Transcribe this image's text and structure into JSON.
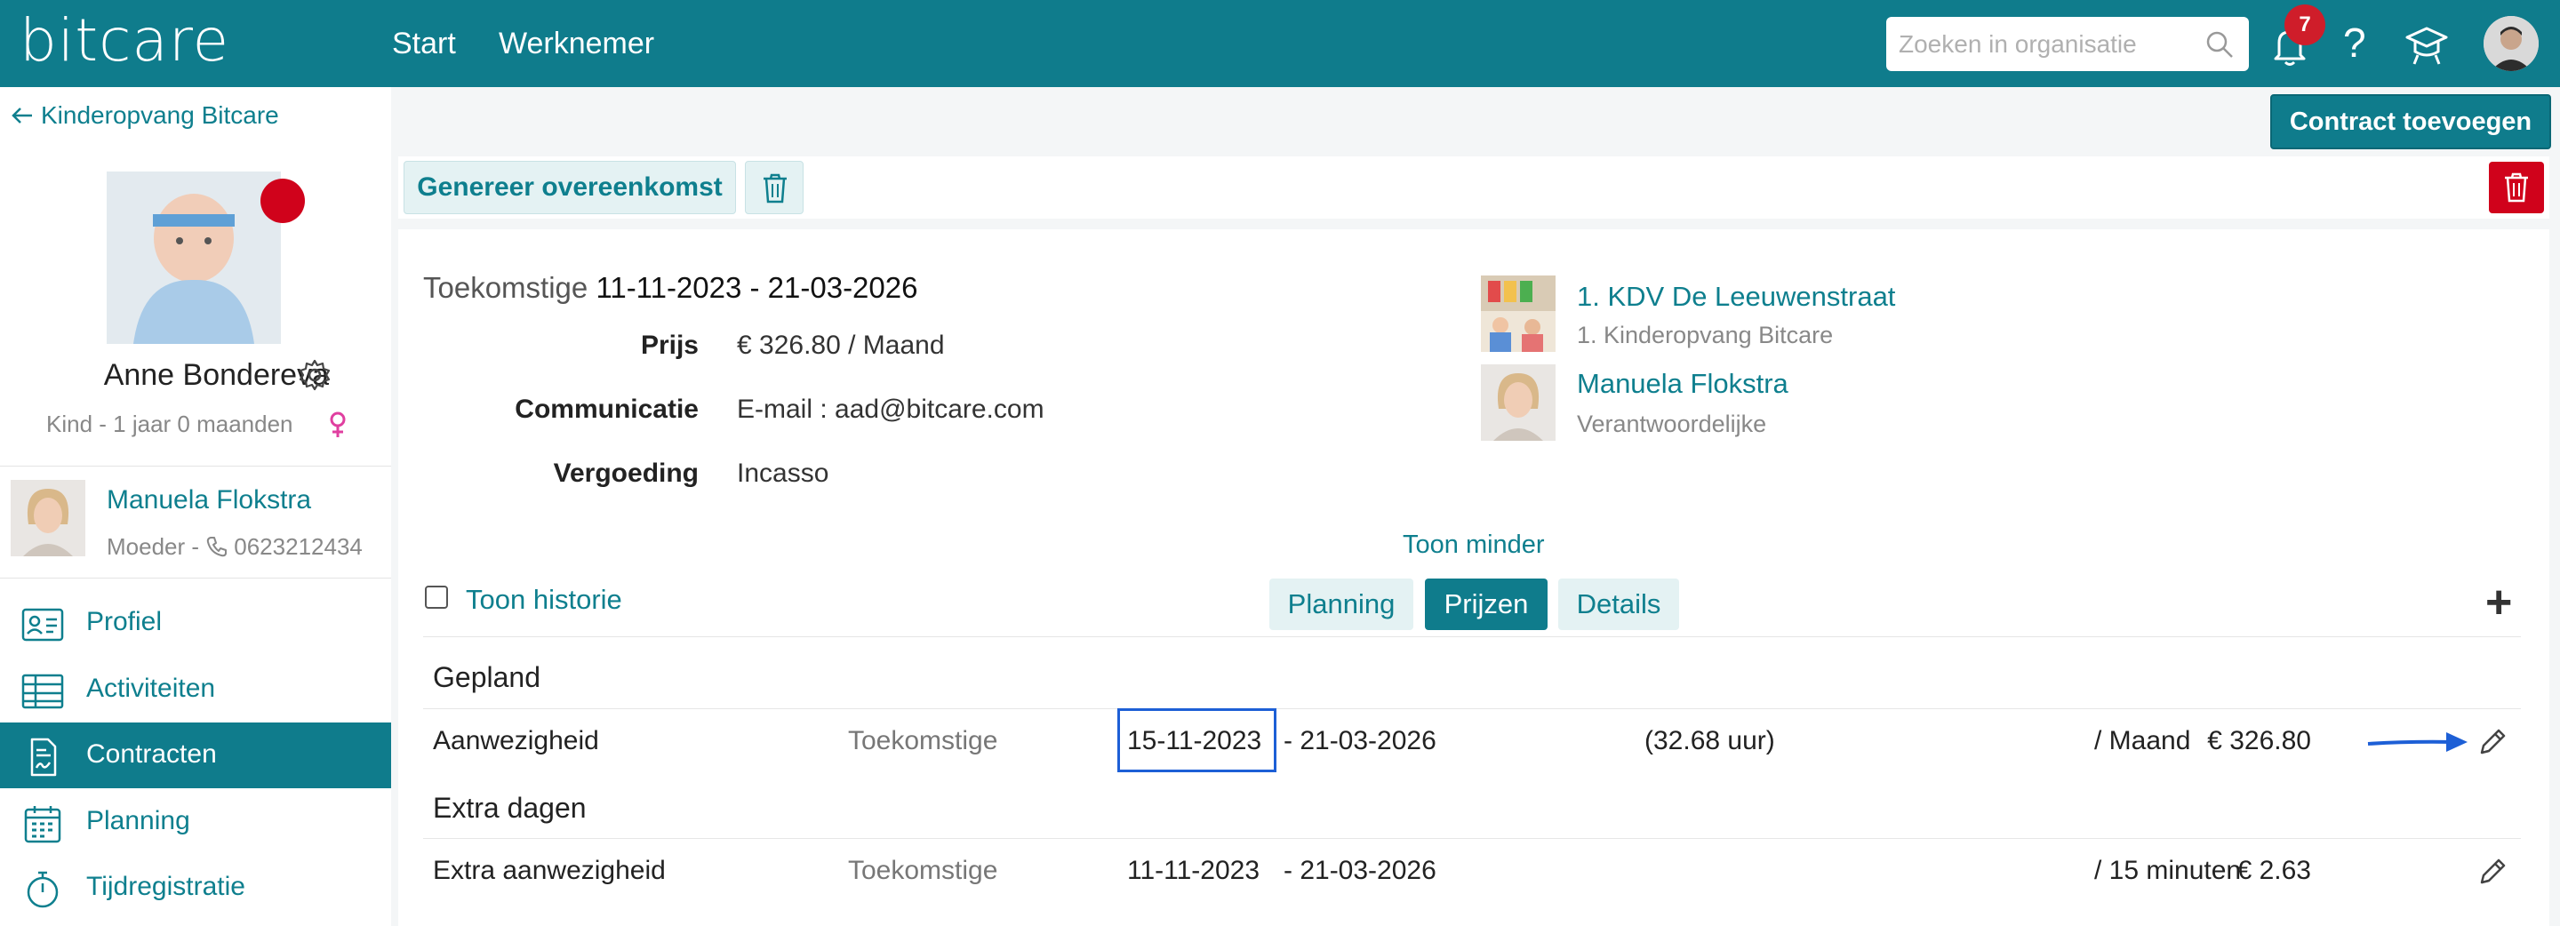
{
  "header": {
    "logo": "bitcare",
    "nav": [
      "Start",
      "Werknemer"
    ],
    "search_placeholder": "Zoeken in organisatie",
    "notification_count": "7",
    "help": "?"
  },
  "sidebar": {
    "back_label": "Kinderopvang Bitcare",
    "child_name": "Anne Bondereva",
    "child_meta": "Kind - 1 jaar 0 maanden",
    "parent_name": "Manuela Flokstra",
    "parent_meta": "Moeder - ",
    "parent_phone": "0623212434",
    "menu": [
      {
        "label": "Profiel",
        "icon": "profile-card-icon"
      },
      {
        "label": "Activiteiten",
        "icon": "table-icon"
      },
      {
        "label": "Contracten",
        "icon": "document-icon",
        "active": true
      },
      {
        "label": "Planning",
        "icon": "calendar-icon"
      },
      {
        "label": "Tijdregistratie",
        "icon": "stopwatch-icon"
      }
    ]
  },
  "actions": {
    "add_contract": "Contract toevoegen",
    "generate": "Genereer overeenkomst"
  },
  "contract": {
    "status": "Toekomstige",
    "date_range": "11-11-2023 - 21-03-2026",
    "fields": [
      {
        "label": "Prijs",
        "value": "€ 326.80 / Maand"
      },
      {
        "label": "Communicatie",
        "value": "E-mail : aad@bitcare.com"
      },
      {
        "label": "Vergoeding",
        "value": "Incasso"
      }
    ],
    "location": {
      "name": "1. KDV De Leeuwenstraat",
      "org": "1. Kinderopvang Bitcare"
    },
    "responsible": {
      "name": "Manuela Flokstra",
      "role": "Verantwoordelijke"
    },
    "show_less": "Toon minder",
    "show_history": "Toon historie",
    "tabs": [
      {
        "label": "Planning",
        "active": false
      },
      {
        "label": "Prijzen",
        "active": true
      },
      {
        "label": "Details",
        "active": false
      }
    ]
  },
  "prices": {
    "sections": [
      {
        "title": "Gepland",
        "rows": [
          {
            "name": "Aanwezigheid",
            "status": "Toekomstige",
            "start": "15-11-2023",
            "end": "- 21-03-2026",
            "hours": "(32.68 uur)",
            "price": "€ 326.80",
            "unit": "/ Maand"
          }
        ]
      },
      {
        "title": "Extra dagen",
        "rows": [
          {
            "name": "Extra aanwezigheid",
            "status": "Toekomstige",
            "start": "11-11-2023",
            "end": "- 21-03-2026",
            "hours": "",
            "price": "€ 2.63",
            "unit": "/ 15 minuten"
          }
        ]
      }
    ]
  },
  "colors": {
    "brand": "#0f7c8c",
    "danger": "#d0021b",
    "annotation": "#1d5fd6"
  }
}
